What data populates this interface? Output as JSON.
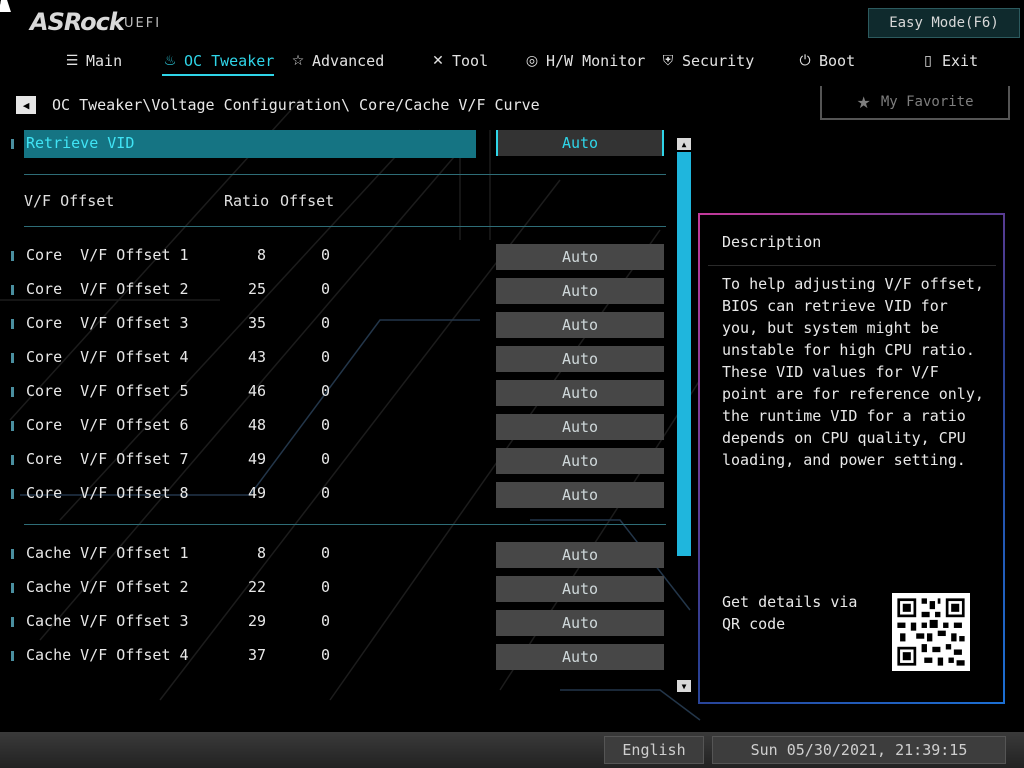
{
  "brand": {
    "logo": "ASRock",
    "edition": "UEFI"
  },
  "easy_mode_label": "Easy Mode(F6)",
  "tabs": [
    {
      "label": "Main",
      "icon": "list-icon"
    },
    {
      "label": "OC Tweaker",
      "icon": "flame-icon",
      "active": true
    },
    {
      "label": "Advanced",
      "icon": "star-icon"
    },
    {
      "label": "Tool",
      "icon": "tools-icon"
    },
    {
      "label": "H/W Monitor",
      "icon": "monitor-icon"
    },
    {
      "label": "Security",
      "icon": "shield-icon"
    },
    {
      "label": "Boot",
      "icon": "power-icon"
    },
    {
      "label": "Exit",
      "icon": "exit-icon"
    }
  ],
  "breadcrumb": "OC Tweaker\\Voltage Configuration\\ Core/Cache V/F Curve",
  "favorite_label": "My Favorite",
  "retrieve_vid": {
    "label": "Retrieve VID",
    "value": "Auto"
  },
  "columns": {
    "name": "V/F Offset",
    "ratio": "Ratio",
    "offset": "Offset"
  },
  "core_rows": [
    {
      "label": "Core  V/F Offset 1",
      "ratio": "8",
      "offset": "0",
      "value": "Auto"
    },
    {
      "label": "Core  V/F Offset 2",
      "ratio": "25",
      "offset": "0",
      "value": "Auto"
    },
    {
      "label": "Core  V/F Offset 3",
      "ratio": "35",
      "offset": "0",
      "value": "Auto"
    },
    {
      "label": "Core  V/F Offset 4",
      "ratio": "43",
      "offset": "0",
      "value": "Auto"
    },
    {
      "label": "Core  V/F Offset 5",
      "ratio": "46",
      "offset": "0",
      "value": "Auto"
    },
    {
      "label": "Core  V/F Offset 6",
      "ratio": "48",
      "offset": "0",
      "value": "Auto"
    },
    {
      "label": "Core  V/F Offset 7",
      "ratio": "49",
      "offset": "0",
      "value": "Auto"
    },
    {
      "label": "Core  V/F Offset 8",
      "ratio": "49",
      "offset": "0",
      "value": "Auto"
    }
  ],
  "cache_rows": [
    {
      "label": "Cache V/F Offset 1",
      "ratio": "8",
      "offset": "0",
      "value": "Auto"
    },
    {
      "label": "Cache V/F Offset 2",
      "ratio": "22",
      "offset": "0",
      "value": "Auto"
    },
    {
      "label": "Cache V/F Offset 3",
      "ratio": "29",
      "offset": "0",
      "value": "Auto"
    },
    {
      "label": "Cache V/F Offset 4",
      "ratio": "37",
      "offset": "0",
      "value": "Auto"
    }
  ],
  "description": {
    "title": "Description",
    "text": "To help adjusting V/F offset, BIOS can retrieve VID for you, but system might be unstable for high CPU ratio. These VID values for V/F point are for reference only, the runtime VID for a ratio depends on CPU quality, CPU loading, and power setting.",
    "qr_text": "Get details via QR code"
  },
  "footer": {
    "language": "English",
    "datetime": "Sun 05/30/2021, 21:39:15"
  },
  "colors": {
    "accent": "#2fd5e8",
    "highlight": "#157483",
    "scroll": "#1fb6dd"
  }
}
